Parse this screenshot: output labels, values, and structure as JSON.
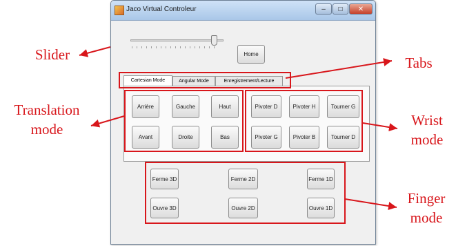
{
  "window": {
    "title": "Jaco Virtual Controleur",
    "min_label": "–",
    "max_label": "□",
    "close_label": "✕",
    "icon": "app-icon"
  },
  "slider": {
    "value_fraction": 0.93
  },
  "buttons": {
    "home": "Home"
  },
  "tabs": [
    {
      "label": "Cartesian Mode",
      "active": true
    },
    {
      "label": "Angular Mode",
      "active": false
    },
    {
      "label": "Enregistrement/Lecture",
      "active": false
    }
  ],
  "translation": [
    "Arrière",
    "Gauche",
    "Haut",
    "Avant",
    "Droite",
    "Bas"
  ],
  "wrist": [
    "Pivoter D",
    "Pivoter H",
    "Tourner G",
    "Pivoter G",
    "Pivoter B",
    "Tourner D"
  ],
  "finger": [
    "Ferme 3D",
    "Ferme 2D",
    "Ferme 1D",
    "Ouvre 3D",
    "Ouvre 2D",
    "Ouvre 1D"
  ],
  "annotations": {
    "slider": "Slider",
    "tabs": "Tabs",
    "translation_line1": "Translation",
    "translation_line2": "mode",
    "wrist_line1": "Wrist",
    "wrist_line2": "mode",
    "finger_line1": "Finger",
    "finger_line2": "mode"
  },
  "colors": {
    "annotation_red": "#d8161b",
    "titlebar": "#a9c7e8",
    "window_bg": "#f0f0f0"
  }
}
